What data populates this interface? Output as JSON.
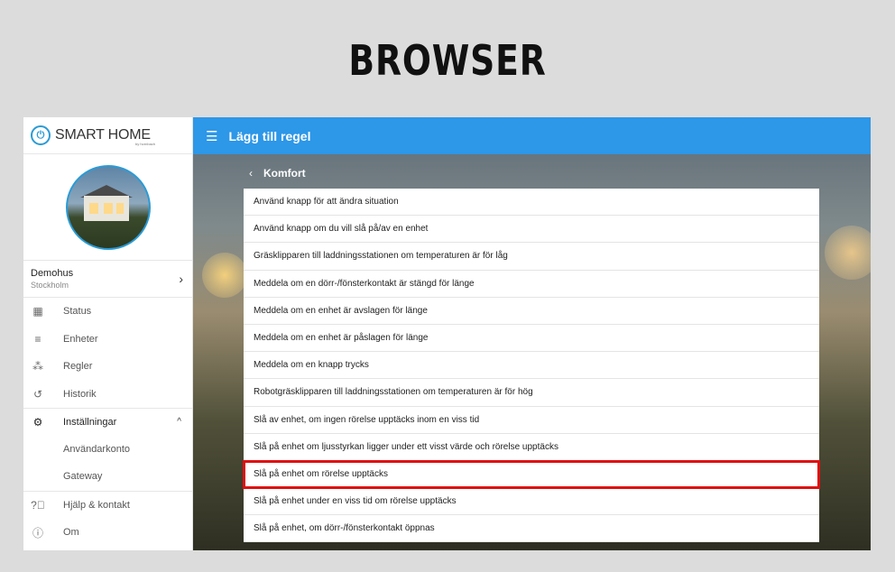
{
  "banner": {
    "title": "BROWSER"
  },
  "sidebar": {
    "logo_text": "SMART HOME",
    "logo_sub": "by hornbach",
    "home": {
      "name": "Demohus",
      "city": "Stockholm"
    },
    "items": [
      {
        "label": "Status",
        "icon": "dashboard-icon"
      },
      {
        "label": "Enheter",
        "icon": "list-icon"
      },
      {
        "label": "Regler",
        "icon": "magic-wand-icon"
      },
      {
        "label": "Historik",
        "icon": "history-icon"
      }
    ],
    "settings": {
      "label": "Inställningar",
      "children": [
        "Användarkonto",
        "Gateway"
      ]
    },
    "footer": [
      {
        "label": "Hjälp & kontakt",
        "icon": "help-icon"
      },
      {
        "label": "Om",
        "icon": "info-icon"
      }
    ]
  },
  "header": {
    "title": "Lägg till regel"
  },
  "breadcrumb": {
    "label": "Komfort"
  },
  "rules": [
    "Använd knapp för att ändra situation",
    "Använd knapp om du vill slå på/av en enhet",
    "Gräsklipparen till laddningsstationen om temperaturen är för låg",
    "Meddela om en dörr-/fönsterkontakt är stängd för länge",
    "Meddela om en enhet är avslagen för länge",
    "Meddela om en enhet är påslagen för länge",
    "Meddela om en knapp trycks",
    "Robotgräsklipparen till laddningsstationen om temperaturen är för hög",
    "Slå av enhet, om ingen rörelse upptäcks inom en viss tid",
    "Slå på enhet om ljusstyrkan ligger under ett visst värde och rörelse upptäcks",
    "Slå på enhet om rörelse upptäcks",
    "Slå på enhet under en viss tid om rörelse upptäcks",
    "Slå på enhet, om dörr-/fönsterkontakt öppnas"
  ],
  "selected_rule_index": 10,
  "colors": {
    "accent": "#2d97e8",
    "highlight": "#e01010"
  }
}
